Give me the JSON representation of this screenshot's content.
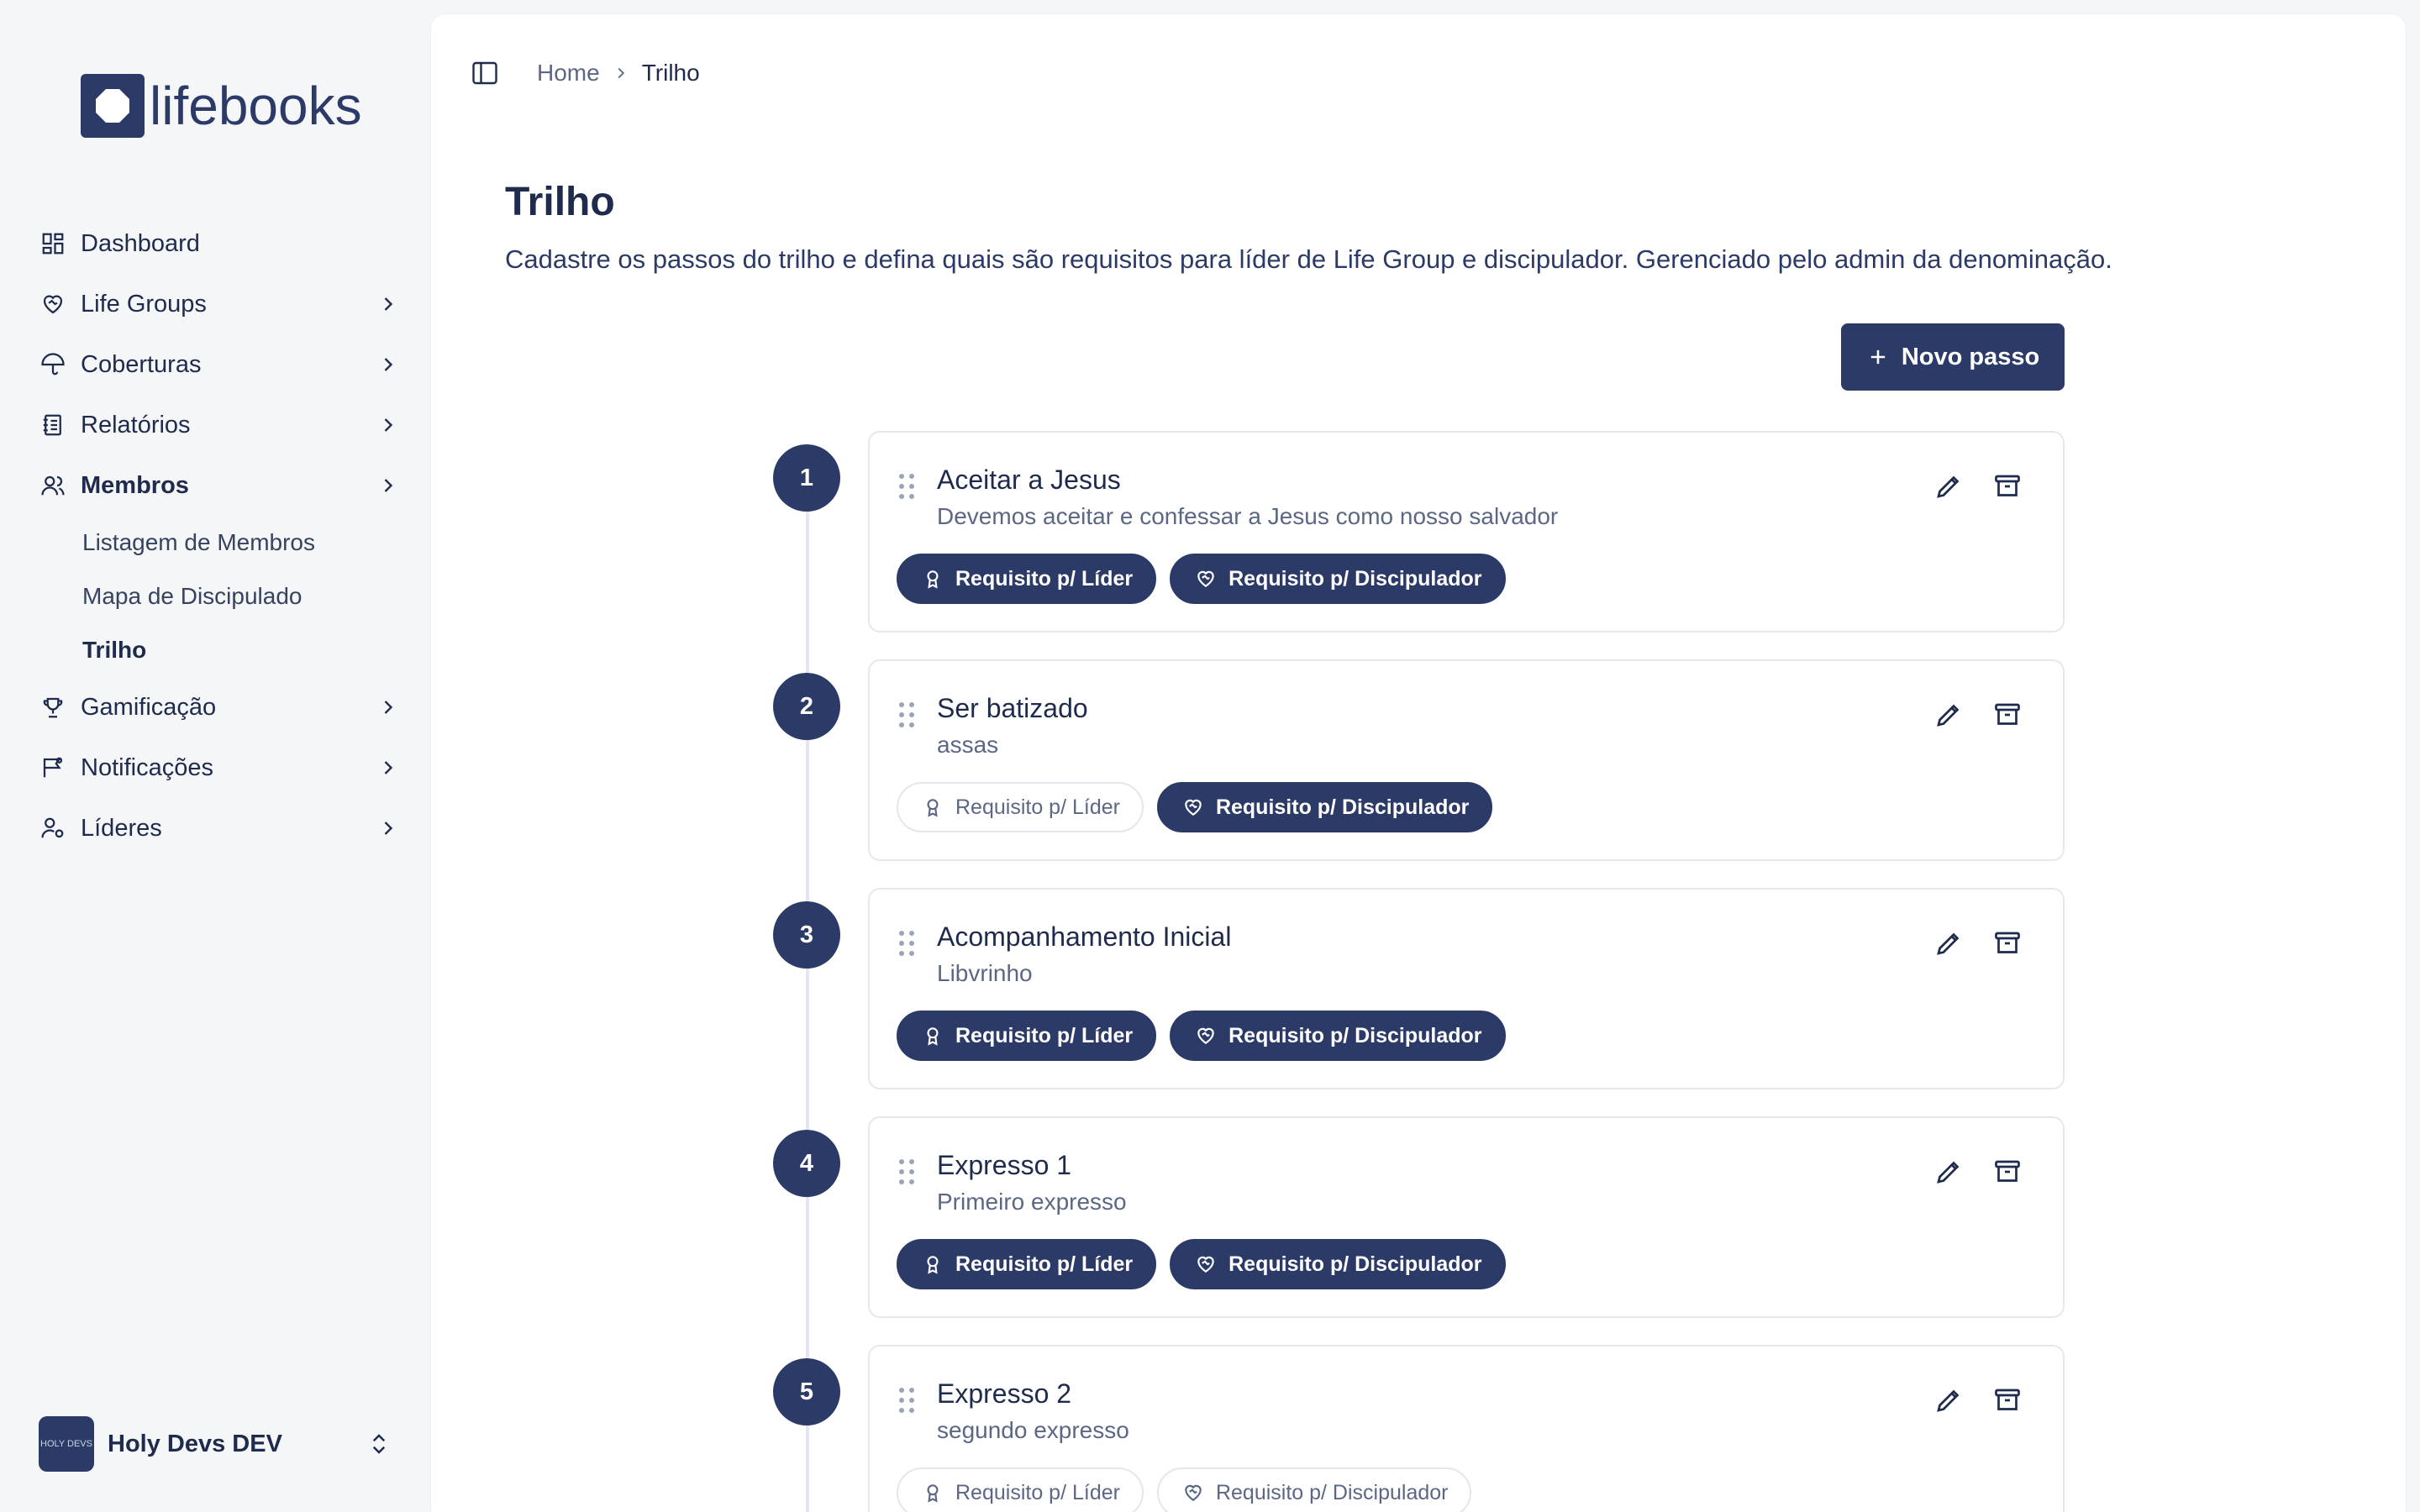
{
  "brand": {
    "name": "lifebooks"
  },
  "sidebar": {
    "items": [
      {
        "label": "Dashboard",
        "icon": "dashboard-icon",
        "has_children": false
      },
      {
        "label": "Life Groups",
        "icon": "heart-handshake-icon",
        "has_children": true
      },
      {
        "label": "Coberturas",
        "icon": "umbrella-icon",
        "has_children": true
      },
      {
        "label": "Relatórios",
        "icon": "notebook-icon",
        "has_children": true
      },
      {
        "label": "Membros",
        "icon": "users-icon",
        "has_children": true,
        "active": true
      },
      {
        "label": "Gamificação",
        "icon": "trophy-icon",
        "has_children": true
      },
      {
        "label": "Notificações",
        "icon": "message-flag-icon",
        "has_children": true
      },
      {
        "label": "Líderes",
        "icon": "user-cog-icon",
        "has_children": true
      }
    ],
    "submenu": [
      {
        "label": "Listagem de Membros"
      },
      {
        "label": "Mapa de Discipulado"
      },
      {
        "label": "Trilho",
        "active": true
      }
    ],
    "footer": {
      "org_name": "Holy Devs DEV",
      "avatar_text": "HOLY DEVS"
    }
  },
  "breadcrumb": {
    "home": "Home",
    "current": "Trilho"
  },
  "page": {
    "title": "Trilho",
    "description": "Cadastre os passos do trilho e defina quais são requisitos para líder de Life Group e discipulador. Gerenciado pelo admin da denominação.",
    "new_button": "Novo passo"
  },
  "badge_labels": {
    "leader": "Requisito p/ Líder",
    "discipler": "Requisito p/ Discipulador"
  },
  "steps": [
    {
      "number": "1",
      "title": "Aceitar a Jesus",
      "description": "Devemos aceitar e confessar a Jesus como nosso salvador",
      "leader": true,
      "discipler": true
    },
    {
      "number": "2",
      "title": "Ser batizado",
      "description": "assas",
      "leader": false,
      "discipler": true
    },
    {
      "number": "3",
      "title": "Acompanhamento Inicial",
      "description": "Libvrinho",
      "leader": true,
      "discipler": true
    },
    {
      "number": "4",
      "title": "Expresso 1",
      "description": "Primeiro expresso",
      "leader": true,
      "discipler": true
    },
    {
      "number": "5",
      "title": "Expresso 2",
      "description": "segundo expresso",
      "leader": false,
      "discipler": false
    }
  ],
  "colors": {
    "primary": "#2b3a67",
    "background": "#f5f6f8",
    "muted": "#5b6784"
  }
}
